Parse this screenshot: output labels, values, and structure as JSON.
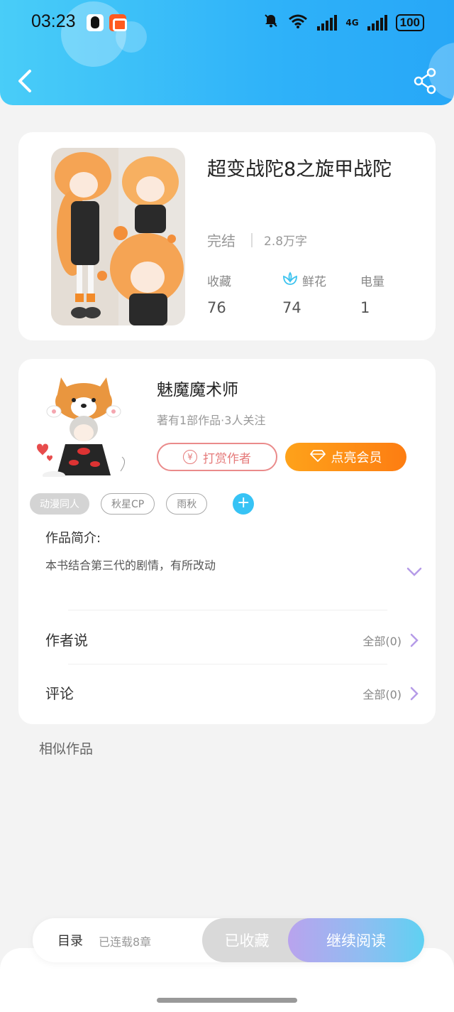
{
  "status_bar": {
    "time": "03:23",
    "network": "4G",
    "battery": "100"
  },
  "book": {
    "title": "超变战陀8之旋甲战陀",
    "status": "完结",
    "word_count": "2.8万字",
    "stats": [
      {
        "label": "收藏",
        "value": "76"
      },
      {
        "label": "鲜花",
        "value": "74"
      },
      {
        "label": "电量",
        "value": "1"
      }
    ]
  },
  "author": {
    "name": "魅魔魔术师",
    "sub": "著有1部作品·3人关注",
    "tip_button": "打赏作者",
    "vip_button": "点亮会员"
  },
  "tags": [
    "动漫同人",
    "秋星CP",
    "雨秋"
  ],
  "intro": {
    "title": "作品简介:",
    "text": "本书结合第三代的剧情，有所改动"
  },
  "rows": [
    {
      "label": "作者说",
      "right": "全部(0)"
    },
    {
      "label": "评论",
      "right": "全部(0)"
    }
  ],
  "similar_label": "相似作品",
  "bottom_bar": {
    "toc": "目录",
    "chapters": "已连载8章",
    "collected": "已收藏",
    "continue": "继续阅读"
  },
  "colors": {
    "header_start": "#49cdf8",
    "header_end": "#27a7f7",
    "vip_orange": "#fd7d12",
    "tip_red": "#e57a7a",
    "accent_purple": "#b59be8"
  }
}
